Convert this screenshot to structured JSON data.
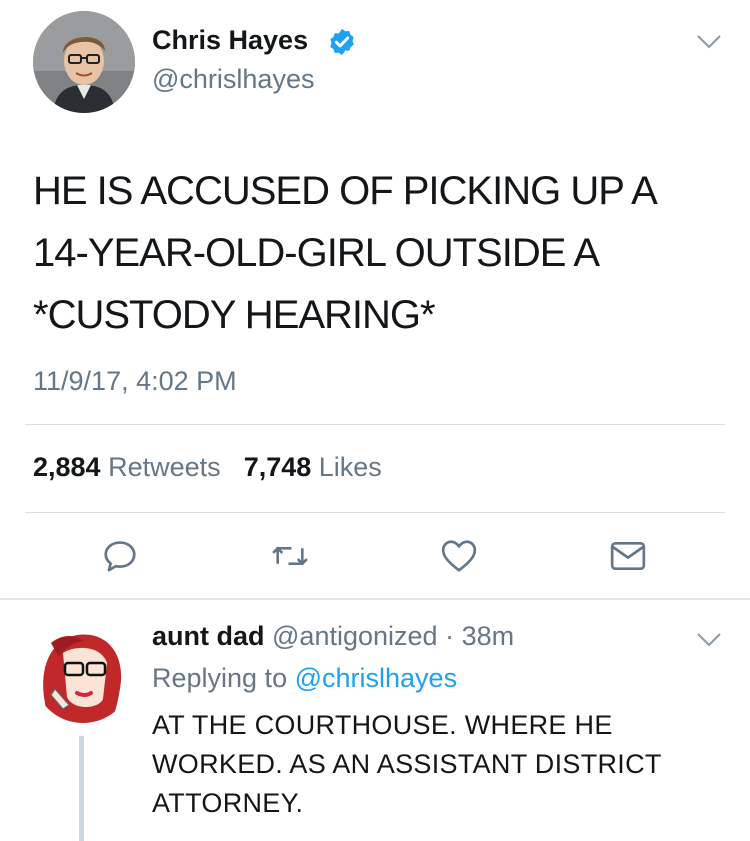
{
  "tweet": {
    "author_name": "Chris Hayes",
    "author_handle": "@chrislhayes",
    "verified": true,
    "text_lines": [
      "HE IS ACCUSED OF PICKING UP A",
      "14-YEAR-OLD-GIRL OUTSIDE A",
      "*CUSTODY HEARING*"
    ],
    "timestamp": "11/9/17, 4:02 PM",
    "retweets_count": "2,884",
    "retweets_label": "Retweets",
    "likes_count": "7,748",
    "likes_label": "Likes",
    "actions": [
      "reply-icon",
      "retweet-icon",
      "like-icon",
      "message-icon"
    ]
  },
  "reply": {
    "author_name": "aunt dad",
    "author_handle": "@antigonized",
    "separator": "·",
    "time_ago": "38m",
    "replying_label": "Replying to",
    "replying_to": "@chrislhayes",
    "text_lines": [
      "AT THE COURTHOUSE. WHERE HE",
      "WORKED. AS AN ASSISTANT DISTRICT",
      "ATTORNEY."
    ]
  },
  "colors": {
    "verified": "#1da1f2",
    "link": "#1da1f2",
    "secondary_text": "#657786",
    "icon": "#657786"
  }
}
